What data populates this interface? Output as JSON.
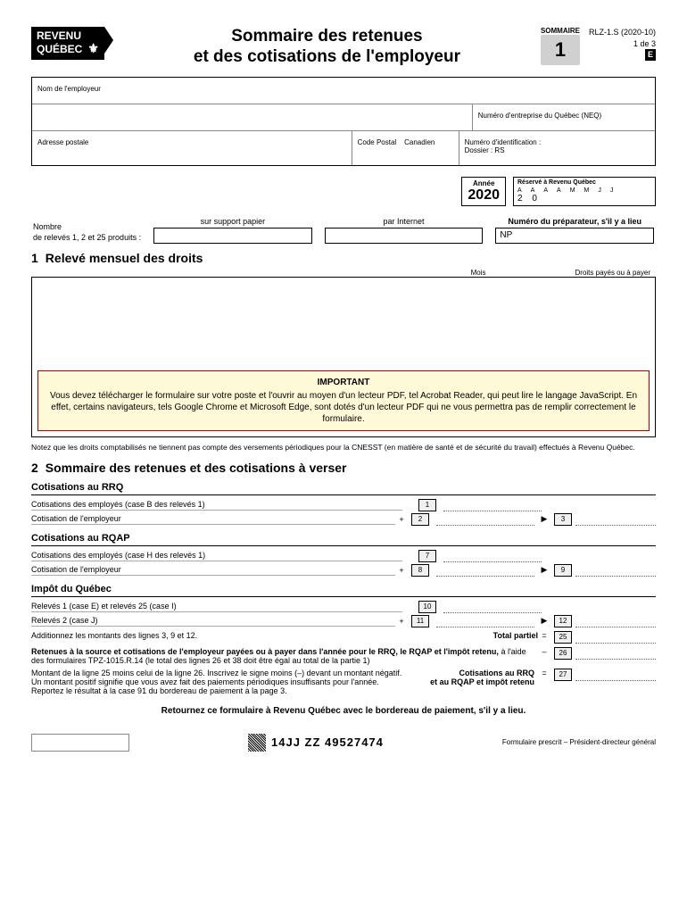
{
  "header": {
    "logo_line1": "REVENU",
    "logo_line2": "QUÉBEC",
    "title_line1": "Sommaire des retenues",
    "title_line2": "et des cotisations de l'employeur",
    "sommaire_label": "SOMMAIRE",
    "sommaire_number": "1",
    "form_code": "RLZ-1.S (2020-10)",
    "page_ref": "1 de 3",
    "e_mark": "E"
  },
  "employer_box": {
    "name_label": "Nom de l'employeur",
    "neq_label": "Numéro d'entreprise du Québec (NEQ)",
    "address_label": "Adresse postale",
    "postal_label": "Code Postal",
    "canadian_label": "Canadien",
    "id_label": "Numéro d'identification :",
    "dossier_label": "Dossier : RS",
    "year_label": "Année",
    "year_value": "2020",
    "reserved_label": "Réservé à Revenu Québec",
    "date_hint_a": "A",
    "date_hint_m": "M",
    "date_hint_j": "J",
    "reserved_prefix": "2  0"
  },
  "counts": {
    "label_line1": "Nombre",
    "label_line2": "de relevés 1, 2 et 25 produits :",
    "paper_caption": "sur support papier",
    "internet_caption": "par Internet",
    "preparer_label": "Numéro du préparateur, s'il y a lieu",
    "preparer_prefix": "NP"
  },
  "section1": {
    "number": "1",
    "title": "Relevé mensuel des droits",
    "col_month": "Mois",
    "col_paid": "Droits payés ou à payer",
    "important_title": "IMPORTANT",
    "important_text": "Vous devez télécharger le formulaire sur votre poste et l'ouvrir au moyen d'un lecteur PDF, tel Acrobat Reader, qui peut lire le langage JavaScript. En effet, certains navigateurs, tels Google Chrome et Microsoft Edge, sont dotés d'un lecteur PDF qui ne vous permettra pas de remplir correctement le formulaire.",
    "note": "Notez que les droits comptabilisés ne tiennent pas compte des versements périodiques pour la CNESST (en matière de santé et de sécurité du travail) effectués à Revenu Québec."
  },
  "section2": {
    "number": "2",
    "title": "Sommaire des retenues et des cotisations à verser",
    "rrq_heading": "Cotisations au RRQ",
    "rrq_line1": "Cotisations des employés (case B des relevés 1)",
    "rrq_line2": "Cotisation de l'employeur",
    "rqap_heading": "Cotisations au RQAP",
    "rqap_line7": "Cotisations des employés (case H des relevés 1)",
    "rqap_line8": "Cotisation de l'employeur",
    "impot_heading": "Impôt du Québec",
    "impot_line10": "Relevés 1 (case E) et relevés 25 (case I)",
    "impot_line11": "Relevés 2 (case J)",
    "line_add": "Additionnez les montants des lignes 3, 9 et 12.",
    "total_partiel": "Total partiel",
    "line26_a": "Retenues à la source et cotisations de l'employeur payées ou à payer dans l'année pour le RRQ, le RQAP et l'impôt retenu,",
    "line26_b": " à l'aide des formulaires TPZ-1015.R.14 (le total des lignes 26 et 38 doit être égal au total de la partie 1)",
    "line27_a": "Montant de la ligne 25 moins celui de la ligne 26. Inscrivez le signe moins (–) devant un montant négatif.",
    "line27_b": "Un montant positif signifie que vous avez fait des paiements périodiques insuffisants pour l'année.",
    "line27_c": "Reportez le résultat à la case 91 du bordereau de paiement à la page 3.",
    "line27_right1": "Cotisations au RRQ",
    "line27_right2": "et au RQAP et impôt retenu",
    "box1": "1",
    "box2": "2",
    "box3": "3",
    "box7": "7",
    "box8": "8",
    "box9": "9",
    "box10": "10",
    "box11": "11",
    "box12": "12",
    "box25": "25",
    "box26": "26",
    "box27": "27",
    "equals": "=",
    "plus": "+",
    "minus": "–",
    "arrow": "▶"
  },
  "bottom": {
    "return_note": "Retournez ce formulaire à Revenu Québec avec le bordereau de paiement, s'il y a lieu.",
    "barcode_text": "14JJ ZZ 49527474",
    "prescribed": "Formulaire prescrit – Président-directeur général"
  }
}
